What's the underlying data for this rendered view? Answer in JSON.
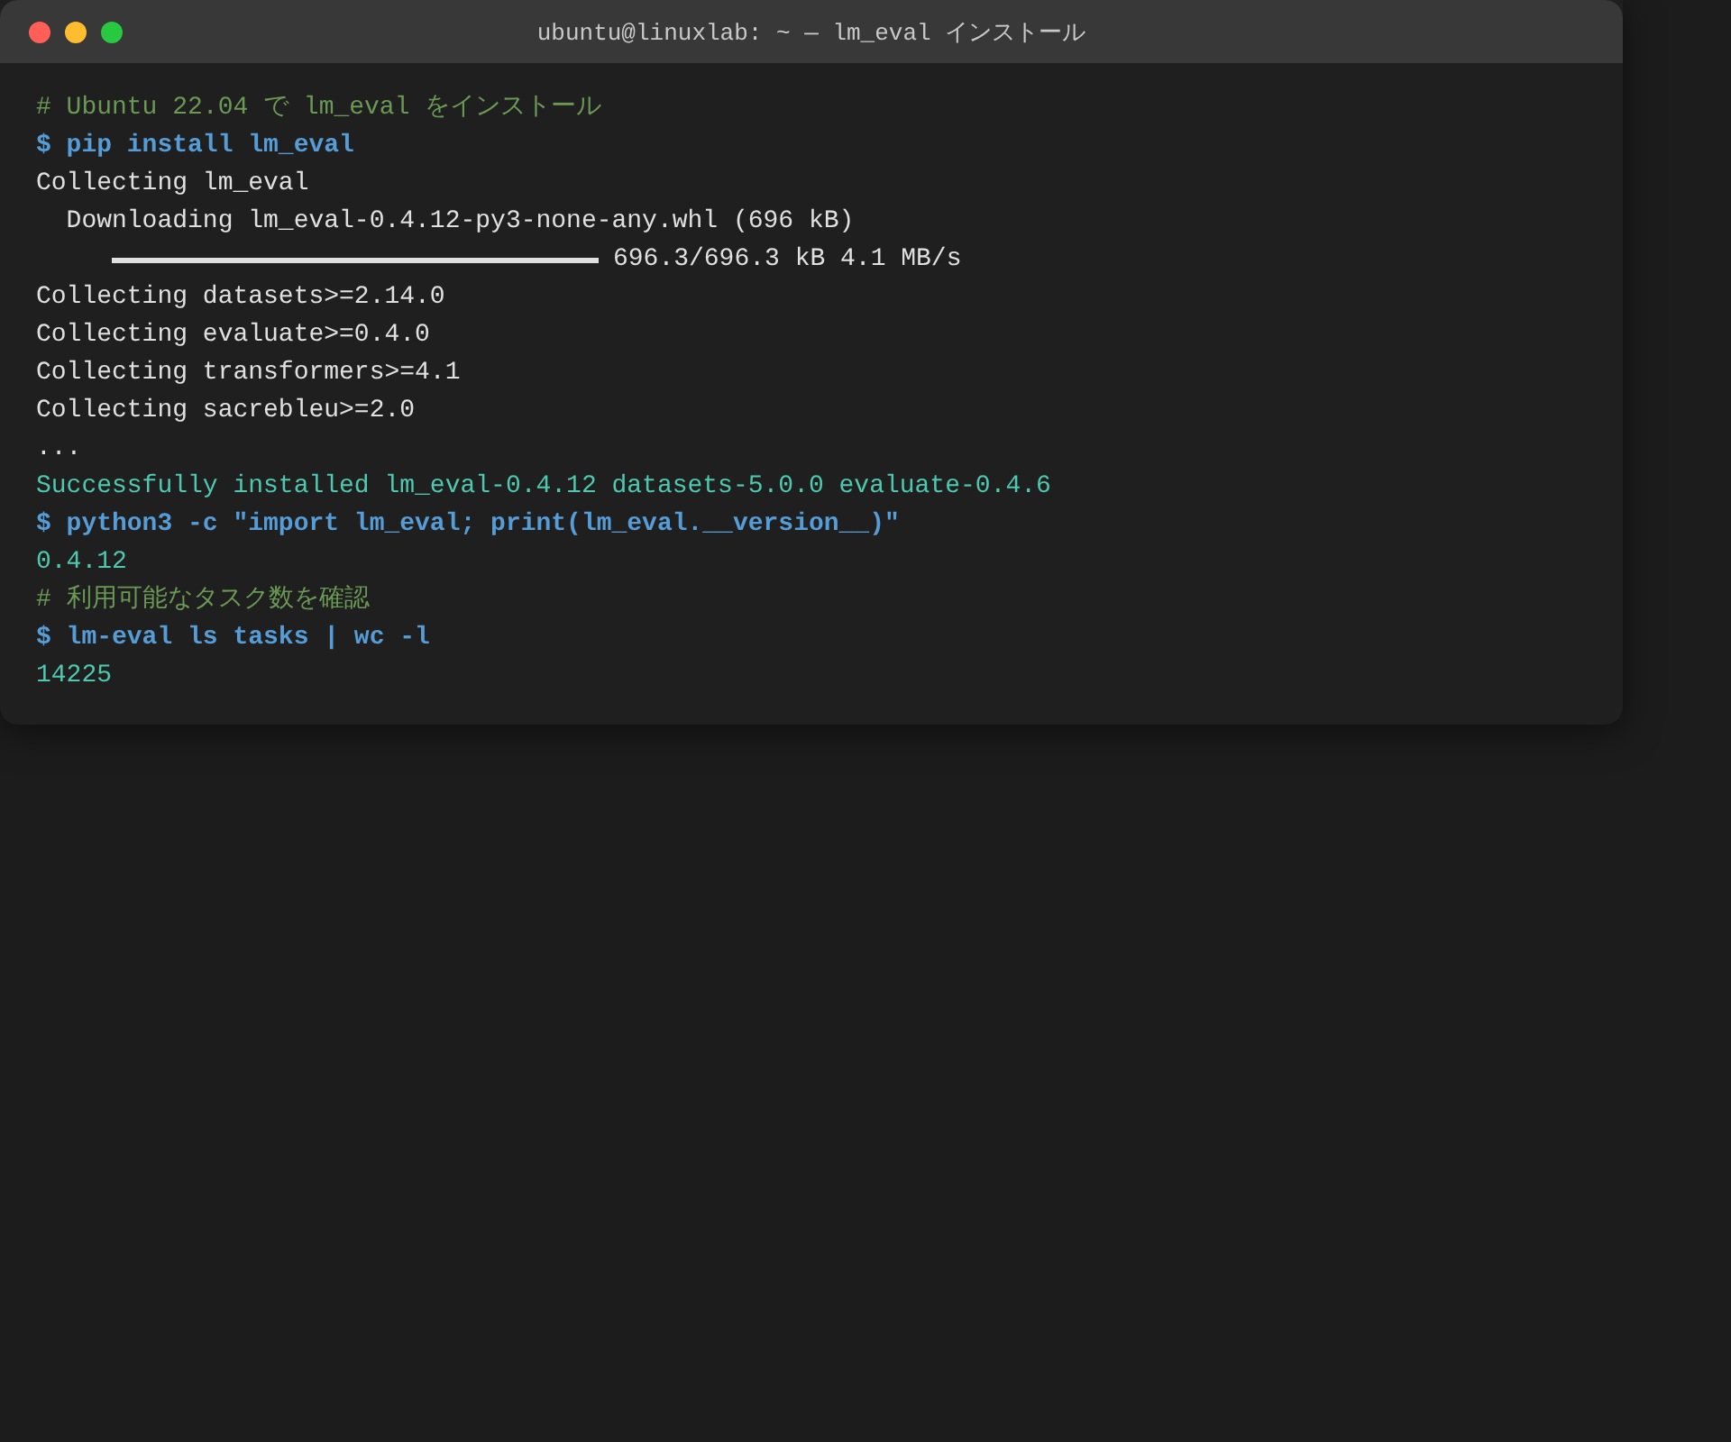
{
  "window": {
    "title": "ubuntu@linuxlab: ~ — lm_eval インストール"
  },
  "lines": [
    {
      "kind": "comment",
      "text": "# Ubuntu 22.04 で lm_eval をインストール"
    },
    {
      "kind": "command",
      "text": "$ pip install lm_eval"
    },
    {
      "kind": "output",
      "text": "Collecting lm_eval"
    },
    {
      "kind": "output",
      "text": "  Downloading lm_eval-0.4.12-py3-none-any.whl (696 kB)"
    },
    {
      "kind": "progress",
      "level": 1,
      "text": "696.3/696.3 kB 4.1 MB/s"
    },
    {
      "kind": "output",
      "text": "Collecting datasets>=2.14.0"
    },
    {
      "kind": "output",
      "text": "Collecting evaluate>=0.4.0"
    },
    {
      "kind": "output",
      "text": "Collecting transformers>=4.1"
    },
    {
      "kind": "output",
      "text": "Collecting sacrebleu>=2.0"
    },
    {
      "kind": "output",
      "text": "..."
    },
    {
      "kind": "success",
      "text": "Successfully installed lm_eval-0.4.12 datasets-5.0.0 evaluate-0.4.6"
    },
    {
      "kind": "command",
      "text": "$ python3 -c \"import lm_eval; print(lm_eval.__version__)\""
    },
    {
      "kind": "success",
      "text": "0.4.12"
    },
    {
      "kind": "comment",
      "text": "# 利用可能なタスク数を確認"
    },
    {
      "kind": "command",
      "text": "$ lm-eval ls tasks | wc -l"
    },
    {
      "kind": "success",
      "text": "14225"
    }
  ]
}
